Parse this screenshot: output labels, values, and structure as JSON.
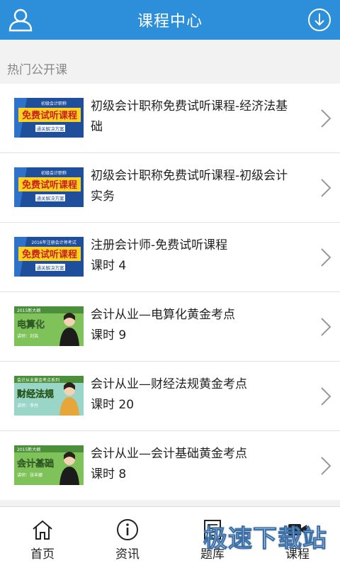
{
  "header": {
    "title": "课程中心",
    "left_icon": "user-icon",
    "right_icon": "download-icon"
  },
  "section": {
    "title": "热门公开课"
  },
  "courses": [
    {
      "title": "初级会计职称免费试听课程-经济法基础",
      "sub": "",
      "thumb": {
        "top": "初级会计职称",
        "main": "免费试听课程",
        "bottom": "通关解决方案",
        "style": "blue"
      }
    },
    {
      "title": "初级会计职称免费试听课程-初级会计实务",
      "sub": "",
      "thumb": {
        "top": "初级会计职称",
        "main": "免费试听课程",
        "bottom": "通关解决方案",
        "style": "blue"
      }
    },
    {
      "title": "注册会计师-免费试听课程",
      "sub": "课时 4",
      "thumb": {
        "top": "2016年注册会计师考试",
        "main": "免费试听课程",
        "bottom": "通关解决方案",
        "style": "blue"
      }
    },
    {
      "title": "会计从业—电算化黄金考点",
      "sub": "课时 9",
      "thumb": {
        "top": "2015新大纲",
        "main": "电算化",
        "bottom": "讲师：刘浩",
        "style": "green"
      }
    },
    {
      "title": "会计从业—财经法规黄金考点",
      "sub": "课时 20",
      "thumb": {
        "top": "会计从业黄金考点系列",
        "main": "财经法规",
        "bottom": "讲师：李丹",
        "style": "teal"
      }
    },
    {
      "title": "会计从业—会计基础黄金考点",
      "sub": "课时 8",
      "thumb": {
        "top": "2015新大纲",
        "main": "会计基础",
        "bottom": "讲师：张丰娜",
        "style": "green"
      }
    }
  ],
  "tabs": [
    {
      "label": "首页",
      "icon": "home-icon"
    },
    {
      "label": "资讯",
      "icon": "info-icon"
    },
    {
      "label": "题库",
      "icon": "document-icon"
    },
    {
      "label": "课程",
      "icon": "video-icon"
    }
  ],
  "watermark": "极速下载站",
  "colors": {
    "header": "#2d8fd9",
    "thumb_blue": "#1f4f9a",
    "thumb_yellow": "#ffd21f",
    "thumb_green": "#7fc25a"
  }
}
